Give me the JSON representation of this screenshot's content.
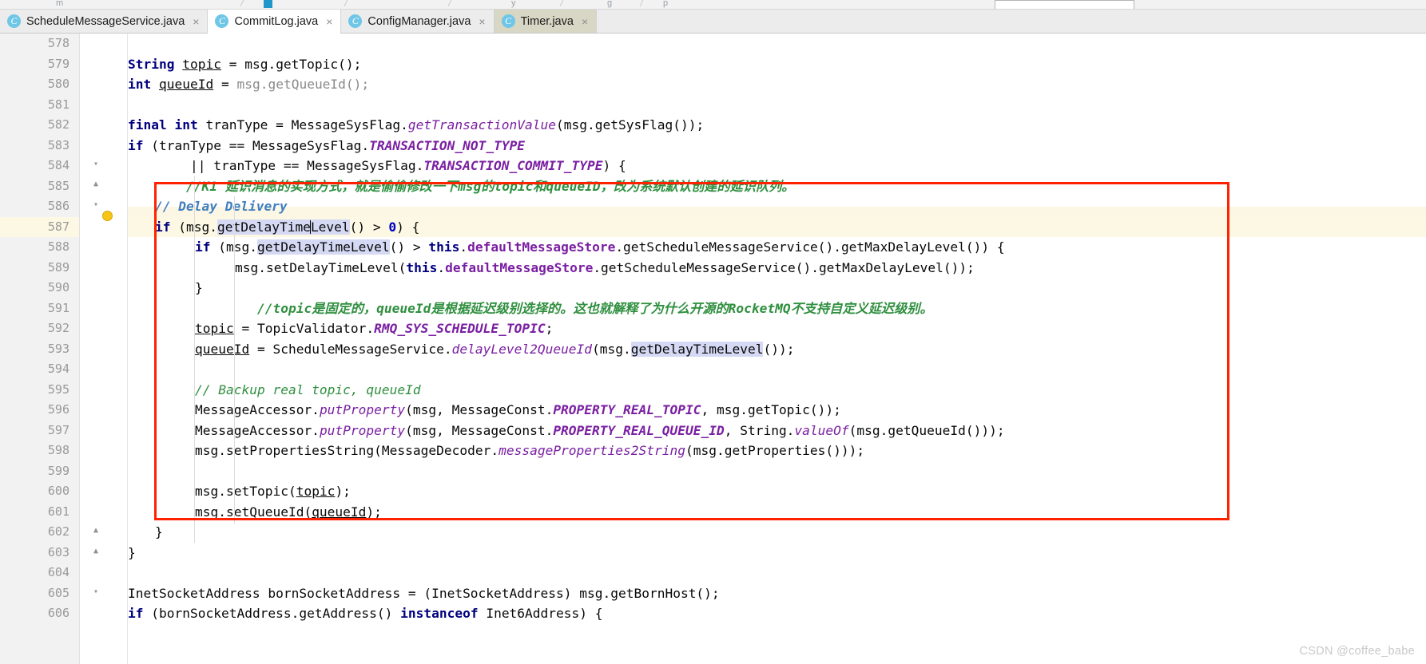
{
  "window": {
    "title": "CommitLog.java",
    "watermark": "CSDN @coffee_babe"
  },
  "toolbar": {
    "ghost_items": [
      "m",
      "p",
      "y",
      "g",
      "p"
    ],
    "separators": [
      "/",
      "/",
      "/",
      "/",
      "/",
      "/"
    ]
  },
  "tabs": [
    {
      "label": "ScheduleMessageService.java",
      "icon": "java-class-icon",
      "close": "×",
      "state": "inactive"
    },
    {
      "label": "CommitLog.java",
      "icon": "java-class-icon",
      "close": "×",
      "state": "active"
    },
    {
      "label": "ConfigManager.java",
      "icon": "java-class-icon",
      "close": "×",
      "state": "inactive"
    },
    {
      "label": "Timer.java",
      "icon": "java-class-icon",
      "close": "×",
      "state": "tinted"
    }
  ],
  "editor": {
    "first_line": 578,
    "last_line": 606,
    "highlighted_line": 587,
    "caret_line": 587,
    "line_numbers": [
      578,
      579,
      580,
      581,
      582,
      583,
      584,
      585,
      586,
      587,
      588,
      589,
      590,
      591,
      592,
      593,
      594,
      595,
      596,
      597,
      598,
      599,
      600,
      601,
      602,
      603,
      604,
      605,
      606
    ],
    "lines": {
      "578": "",
      "579": "String topic = msg.getTopic();",
      "580": "int queueId = msg.getQueueId();",
      "581": "",
      "582": "final int tranType = MessageSysFlag.getTransactionValue(msg.getSysFlag());",
      "583": "if (tranType == MessageSysFlag.TRANSACTION_NOT_TYPE",
      "584": "        || tranType == MessageSysFlag.TRANSACTION_COMMIT_TYPE) {",
      "585": "    //K1 延识消息的实现方式，就是偷偷修改一下msg的topic和queueID，改为系统默认创建的延识队列。",
      "586": "    // Delay Delivery",
      "587": "    if (msg.getDelayTimeLevel() > 0) {",
      "588": "        if (msg.getDelayTimeLevel() > this.defaultMessageStore.getScheduleMessageService().getMaxDelayLevel()) {",
      "589": "            msg.setDelayTimeLevel(this.defaultMessageStore.getScheduleMessageService().getMaxDelayLevel());",
      "590": "        }",
      "591": "        //topic是固定的，queueId是根据延迟级别选择的。这也就解释了为什么开源的RocketMQ不支持自定义延迟级别。",
      "592": "        topic = TopicValidator.RMQ_SYS_SCHEDULE_TOPIC;",
      "593": "        queueId = ScheduleMessageService.delayLevel2QueueId(msg.getDelayTimeLevel());",
      "594": "",
      "595": "        // Backup real topic, queueId",
      "596": "        MessageAccessor.putProperty(msg, MessageConst.PROPERTY_REAL_TOPIC, msg.getTopic());",
      "597": "        MessageAccessor.putProperty(msg, MessageConst.PROPERTY_REAL_QUEUE_ID, String.valueOf(msg.getQueueId()));",
      "598": "        msg.setPropertiesString(MessageDecoder.messageProperties2String(msg.getProperties()));",
      "599": "",
      "600": "        msg.setTopic(topic);",
      "601": "        msg.setQueueId(queueId);",
      "602": "    }",
      "603": "}",
      "604": "",
      "605": "InetSocketAddress bornSocketAddress = (InetSocketAddress) msg.getBornHost();",
      "606": "if (bornSocketAddress.getAddress() instanceof Inet6Address) {"
    },
    "gutter_icons": {
      "584": "fold-collapse-icon",
      "585": "fold-collapse-icon",
      "587": "fold-collapse-icon",
      "602": "fold-collapse-icon",
      "603": "fold-collapse-icon",
      "606": "fold-collapse-icon"
    },
    "inspection_bulb": {
      "line": 587,
      "name": "intention-bulb-icon"
    }
  },
  "annotation": {
    "name": "red-highlight-rectangle",
    "color": "#ff2200",
    "covers_lines": "586-603"
  },
  "colors": {
    "keyword": "#000080",
    "comment": "#2f8f3f",
    "doc_comment": "#3f7fbf",
    "constant": "#7a1fa2",
    "number": "#0000c0",
    "grayed": "#8a8a8a",
    "selection": "#d5d9f4",
    "highlight_row": "#fdf8e3",
    "annotation": "#ff2200"
  }
}
